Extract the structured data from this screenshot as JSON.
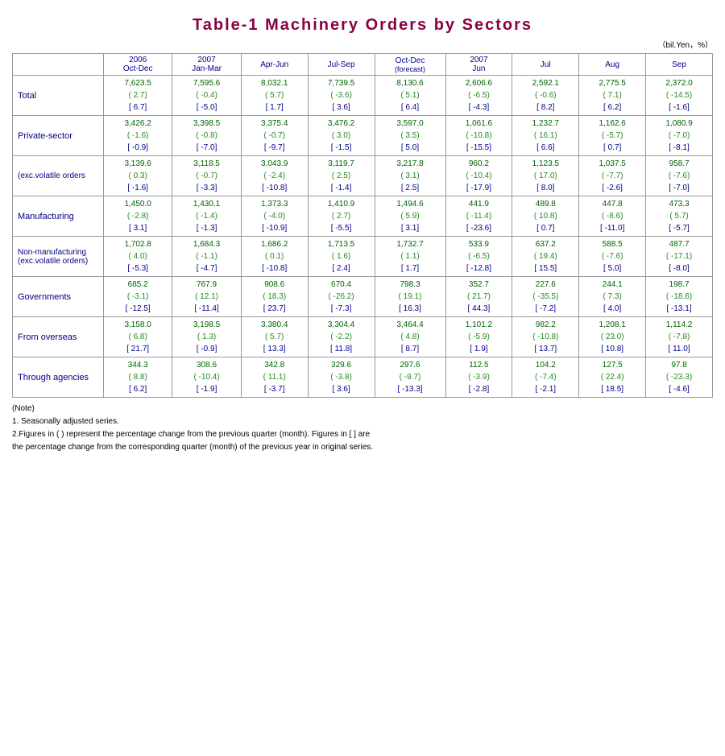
{
  "title": "Table-1  Machinery  Orders  by  Sectors",
  "unit": "（bil.Yen，%）",
  "headers": {
    "col1_year": "2006",
    "col1_period": "Oct-Dec",
    "col2_year": "2007",
    "col2_period": "Jan-Mar",
    "col3_period": "Apr-Jun",
    "col4_period": "Jul-Sep",
    "col5_period": "Oct-Dec",
    "col5_note": "(forecast)",
    "col6_year": "2007",
    "col6_period": "Jun",
    "col7_period": "Jul",
    "col8_period": "Aug",
    "col9_period": "Sep"
  },
  "rows": [
    {
      "label": "Total",
      "sublabel": "",
      "data": [
        {
          "main": "7,623.5",
          "paren": "( 2.7)",
          "bracket": "[ 6.7]"
        },
        {
          "main": "7,595.6",
          "paren": "( -0.4)",
          "bracket": "[ -5.0]"
        },
        {
          "main": "8,032.1",
          "paren": "( 5.7)",
          "bracket": "[ 1.7]"
        },
        {
          "main": "7,739.5",
          "paren": "( -3.6)",
          "bracket": "[ 3.6]"
        },
        {
          "main": "8,130.6",
          "paren": "( 5.1)",
          "bracket": "[ 6.4]"
        },
        {
          "main": "2,606.6",
          "paren": "( -6.5)",
          "bracket": "[ -4.3]"
        },
        {
          "main": "2,592.1",
          "paren": "( -0.6)",
          "bracket": "[ 8.2]"
        },
        {
          "main": "2,775.5",
          "paren": "( 7.1)",
          "bracket": "[ 6.2]"
        },
        {
          "main": "2,372.0",
          "paren": "( -14.5)",
          "bracket": "[ -1.6]"
        }
      ]
    },
    {
      "label": "Private-sector",
      "sublabel": "",
      "data": [
        {
          "main": "3,426.2",
          "paren": "( -1.6)",
          "bracket": "[ -0.9]"
        },
        {
          "main": "3,398.5",
          "paren": "( -0.8)",
          "bracket": "[ -7.0]"
        },
        {
          "main": "3,375.4",
          "paren": "( -0.7)",
          "bracket": "[ -9.7]"
        },
        {
          "main": "3,476.2",
          "paren": "( 3.0)",
          "bracket": "[ -1.5]"
        },
        {
          "main": "3,597.0",
          "paren": "( 3.5)",
          "bracket": "[ 5.0]"
        },
        {
          "main": "1,061.6",
          "paren": "( -10.8)",
          "bracket": "[ -15.5]"
        },
        {
          "main": "1,232.7",
          "paren": "( 16.1)",
          "bracket": "[ 6.6]"
        },
        {
          "main": "1,162.6",
          "paren": "( -5.7)",
          "bracket": "[ 0.7]"
        },
        {
          "main": "1,080.9",
          "paren": "( -7.0)",
          "bracket": "[ -8.1]"
        }
      ]
    },
    {
      "label": "(exc.volatile orders",
      "sublabel": "",
      "data": [
        {
          "main": "3,139.6",
          "paren": "( 0.3)",
          "bracket": "[ -1.6]"
        },
        {
          "main": "3,118.5",
          "paren": "( -0.7)",
          "bracket": "[ -3.3]"
        },
        {
          "main": "3,043.9",
          "paren": "( -2.4)",
          "bracket": "[ -10.8]"
        },
        {
          "main": "3,119.7",
          "paren": "( 2.5)",
          "bracket": "[ -1.4]"
        },
        {
          "main": "3,217.8",
          "paren": "( 3.1)",
          "bracket": "[ 2.5]"
        },
        {
          "main": "960.2",
          "paren": "( -10.4)",
          "bracket": "[ -17.9]"
        },
        {
          "main": "1,123.5",
          "paren": "( 17.0)",
          "bracket": "[ 8.0]"
        },
        {
          "main": "1,037.5",
          "paren": "( -7.7)",
          "bracket": "[ -2.6]"
        },
        {
          "main": "958.7",
          "paren": "( -7.6)",
          "bracket": "[ -7.0]"
        }
      ]
    },
    {
      "label": "Manufacturing",
      "sublabel": "",
      "data": [
        {
          "main": "1,450.0",
          "paren": "( -2.8)",
          "bracket": "[ 3.1]"
        },
        {
          "main": "1,430.1",
          "paren": "( -1.4)",
          "bracket": "[ -1.3]"
        },
        {
          "main": "1,373.3",
          "paren": "( -4.0)",
          "bracket": "[ -10.9]"
        },
        {
          "main": "1,410.9",
          "paren": "( 2.7)",
          "bracket": "[ -5.5]"
        },
        {
          "main": "1,494.6",
          "paren": "( 5.9)",
          "bracket": "[ 3.1]"
        },
        {
          "main": "441.9",
          "paren": "( -11.4)",
          "bracket": "[ -23.6]"
        },
        {
          "main": "489.8",
          "paren": "( 10.8)",
          "bracket": "[ 0.7]"
        },
        {
          "main": "447.8",
          "paren": "( -8.6)",
          "bracket": "[ -11.0]"
        },
        {
          "main": "473.3",
          "paren": "( 5.7)",
          "bracket": "[ -5.7]"
        }
      ]
    },
    {
      "label": "Non-manufacturing (exc.volatile orders)",
      "sublabel": "",
      "data": [
        {
          "main": "1,702.8",
          "paren": "( 4.0)",
          "bracket": "[ -5.3]"
        },
        {
          "main": "1,684.3",
          "paren": "( -1.1)",
          "bracket": "[ -4.7]"
        },
        {
          "main": "1,686.2",
          "paren": "( 0.1)",
          "bracket": "[ -10.8]"
        },
        {
          "main": "1,713.5",
          "paren": "( 1.6)",
          "bracket": "[ 2.4]"
        },
        {
          "main": "1,732.7",
          "paren": "( 1.1)",
          "bracket": "[ 1.7]"
        },
        {
          "main": "533.9",
          "paren": "( -6.5)",
          "bracket": "[ -12.8]"
        },
        {
          "main": "637.2",
          "paren": "( 19.4)",
          "bracket": "[ 15.5]"
        },
        {
          "main": "588.5",
          "paren": "( -7.6)",
          "bracket": "[ 5.0]"
        },
        {
          "main": "487.7",
          "paren": "( -17.1)",
          "bracket": "[ -8.0]"
        }
      ]
    },
    {
      "label": "Governments",
      "sublabel": "",
      "data": [
        {
          "main": "685.2",
          "paren": "( -3.1)",
          "bracket": "[ -12.5]"
        },
        {
          "main": "767.9",
          "paren": "( 12.1)",
          "bracket": "[ -11.4]"
        },
        {
          "main": "908.6",
          "paren": "( 18.3)",
          "bracket": "[ 23.7]"
        },
        {
          "main": "670.4",
          "paren": "( -26.2)",
          "bracket": "[ -7.3]"
        },
        {
          "main": "798.3",
          "paren": "( 19.1)",
          "bracket": "[ 16.3]"
        },
        {
          "main": "352.7",
          "paren": "( 21.7)",
          "bracket": "[ 44.3]"
        },
        {
          "main": "227.6",
          "paren": "( -35.5)",
          "bracket": "[ -7.2]"
        },
        {
          "main": "244.1",
          "paren": "( 7.3)",
          "bracket": "[ 4.0]"
        },
        {
          "main": "198.7",
          "paren": "( -18.6)",
          "bracket": "[ -13.1]"
        }
      ]
    },
    {
      "label": "From overseas",
      "sublabel": "",
      "data": [
        {
          "main": "3,158.0",
          "paren": "( 6.8)",
          "bracket": "[ 21.7]"
        },
        {
          "main": "3,198.5",
          "paren": "( 1.3)",
          "bracket": "[ -0.9]"
        },
        {
          "main": "3,380.4",
          "paren": "( 5.7)",
          "bracket": "[ 13.3]"
        },
        {
          "main": "3,304.4",
          "paren": "( -2.2)",
          "bracket": "[ 11.8]"
        },
        {
          "main": "3,464.4",
          "paren": "( 4.8)",
          "bracket": "[ 8.7]"
        },
        {
          "main": "1,101.2",
          "paren": "( -5.9)",
          "bracket": "[ 1.9]"
        },
        {
          "main": "982.2",
          "paren": "( -10.8)",
          "bracket": "[ 13.7]"
        },
        {
          "main": "1,208.1",
          "paren": "( 23.0)",
          "bracket": "[ 10.8]"
        },
        {
          "main": "1,114.2",
          "paren": "( -7.8)",
          "bracket": "[ 11.0]"
        }
      ]
    },
    {
      "label": "Through agencies",
      "sublabel": "",
      "data": [
        {
          "main": "344.3",
          "paren": "( 8.8)",
          "bracket": "[ 6.2]"
        },
        {
          "main": "308.6",
          "paren": "( -10.4)",
          "bracket": "[ -1.9]"
        },
        {
          "main": "342.8",
          "paren": "( 11.1)",
          "bracket": "[ -3.7]"
        },
        {
          "main": "329.6",
          "paren": "( -3.8)",
          "bracket": "[ 3.6]"
        },
        {
          "main": "297.6",
          "paren": "( -9.7)",
          "bracket": "[ -13.3]"
        },
        {
          "main": "112.5",
          "paren": "( -3.9)",
          "bracket": "[ -2.8]"
        },
        {
          "main": "104.2",
          "paren": "( -7.4)",
          "bracket": "[ -2.1]"
        },
        {
          "main": "127.5",
          "paren": "( 22.4)",
          "bracket": "[ 18.5]"
        },
        {
          "main": "97.8",
          "paren": "( -23.3)",
          "bracket": "[ -4.6]"
        }
      ]
    }
  ],
  "notes": {
    "title": "(Note)",
    "items": [
      "1. Seasonally adjusted series.",
      "2.Figures in ( ) represent the percentage change from the previous quarter (month). Figures in [ ] are",
      "  the percentage change from the corresponding quarter (month) of the previous year in original series."
    ]
  }
}
